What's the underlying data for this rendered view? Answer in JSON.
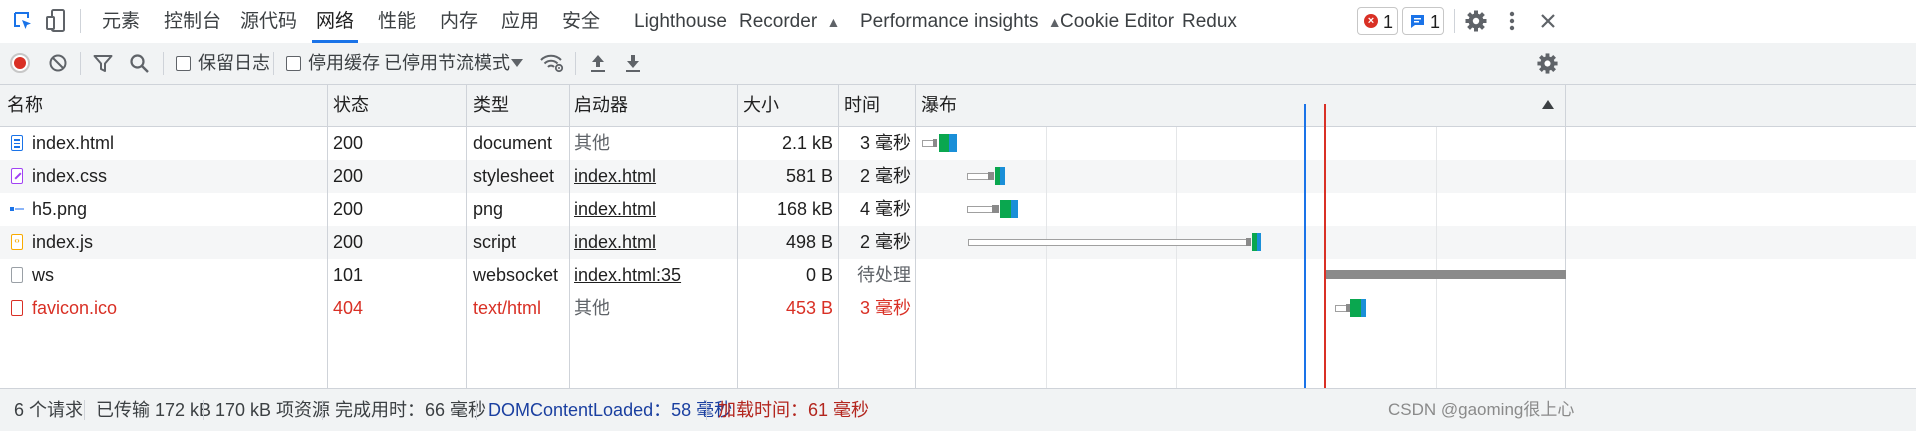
{
  "tabs": {
    "elements": "元素",
    "console": "控制台",
    "sources": "源代码",
    "network": "网络",
    "performance": "性能",
    "memory": "内存",
    "application": "应用",
    "security": "安全",
    "lighthouse": "Lighthouse",
    "recorder": "Recorder",
    "perf_insights": "Performance insights",
    "cookie_editor": "Cookie Editor",
    "redux": "Redux"
  },
  "badges": {
    "errors": "1",
    "messages": "1"
  },
  "toolbar": {
    "preserve_log": "保留日志",
    "disable_cache": "停用缓存",
    "throttling": "已停用节流模式"
  },
  "columns": {
    "name": "名称",
    "status": "状态",
    "type": "类型",
    "initiator": "启动器",
    "size": "大小",
    "time": "时间",
    "waterfall": "瀑布"
  },
  "requests": [
    {
      "name": "index.html",
      "status": "200",
      "type": "document",
      "initiator": "其他",
      "size": "2.1 kB",
      "time": "3 毫秒",
      "icon": "document-icon"
    },
    {
      "name": "index.css",
      "status": "200",
      "type": "stylesheet",
      "initiator": "index.html",
      "size": "581 B",
      "time": "2 毫秒",
      "icon": "stylesheet-icon"
    },
    {
      "name": "h5.png",
      "status": "200",
      "type": "png",
      "initiator": "index.html",
      "size": "168 kB",
      "time": "4 毫秒",
      "icon": "image-icon"
    },
    {
      "name": "index.js",
      "status": "200",
      "type": "script",
      "initiator": "index.html",
      "size": "498 B",
      "time": "2 毫秒",
      "icon": "script-icon"
    },
    {
      "name": "ws",
      "status": "101",
      "type": "websocket",
      "initiator": "index.html:35",
      "size": "0 B",
      "time": "待处理",
      "icon": "websocket-icon"
    },
    {
      "name": "favicon.ico",
      "status": "404",
      "type": "text/html",
      "initiator": "其他",
      "size": "453 B",
      "time": "3 毫秒",
      "icon": "error-file-icon"
    }
  ],
  "status": {
    "requests": "6 个请求",
    "transferred": "已传输 172 kB",
    "resources": "170 kB 项资源",
    "finish": "完成用时：66 毫秒",
    "dom_content_loaded": "DOMContentLoaded：58 毫秒",
    "load": "加载时间：61 毫秒"
  },
  "watermark": "CSDN @gaoming很上心",
  "colors": {
    "accent": "#1a73e8",
    "error": "#d93025",
    "dcl_line": "#1a73e8",
    "load_line": "#d93025",
    "waterfall_green": "#0aa74f",
    "waterfall_blue": "#1a8fd8"
  }
}
